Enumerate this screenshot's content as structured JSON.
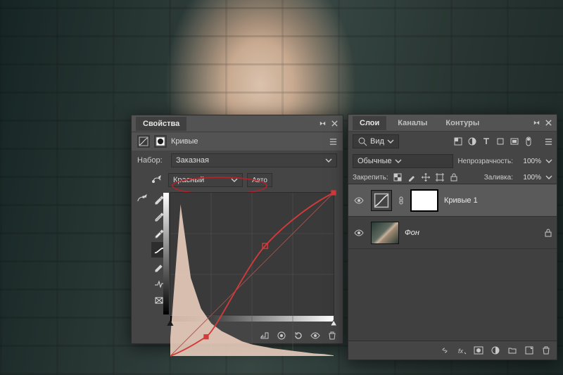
{
  "properties_panel": {
    "title_tab": "Свойства",
    "section_label": "Кривые",
    "preset_label": "Набор:",
    "preset_value": "Заказная",
    "channel_value": "Красный",
    "auto_label": "Авто"
  },
  "layers_panel": {
    "tabs": [
      "Слои",
      "Каналы",
      "Контуры"
    ],
    "active_tab": 0,
    "filter_label": "Вид",
    "blend_mode": "Обычные",
    "opacity_label": "Непрозрачность:",
    "opacity_value": "100%",
    "lock_label": "Закрепить:",
    "fill_label": "Заливка:",
    "fill_value": "100%",
    "layers": [
      {
        "name": "Кривые 1",
        "type": "adjustment",
        "visible": true,
        "selected": true,
        "locked": false,
        "has_mask": true
      },
      {
        "name": "Фон",
        "type": "image",
        "visible": true,
        "selected": false,
        "locked": true,
        "has_mask": false
      }
    ]
  },
  "chart_data": {
    "type": "line",
    "title": "",
    "xlabel": "",
    "ylabel": "",
    "xlim": [
      0,
      255
    ],
    "ylim": [
      0,
      255
    ],
    "channel": "Красный",
    "series": [
      {
        "name": "baseline",
        "x": [
          0,
          255
        ],
        "values": [
          0,
          255
        ]
      },
      {
        "name": "curve",
        "x": [
          0,
          56,
          148,
          255
        ],
        "values": [
          0,
          30,
          172,
          255
        ]
      }
    ],
    "histogram": {
      "x_bins": [
        0,
        16,
        32,
        48,
        64,
        80,
        96,
        112,
        128,
        144,
        160,
        176,
        192,
        208,
        224,
        240,
        255
      ],
      "values": [
        22,
        185,
        95,
        58,
        40,
        30,
        24,
        18,
        14,
        12,
        10,
        8,
        6,
        5,
        3,
        2,
        1
      ]
    }
  }
}
